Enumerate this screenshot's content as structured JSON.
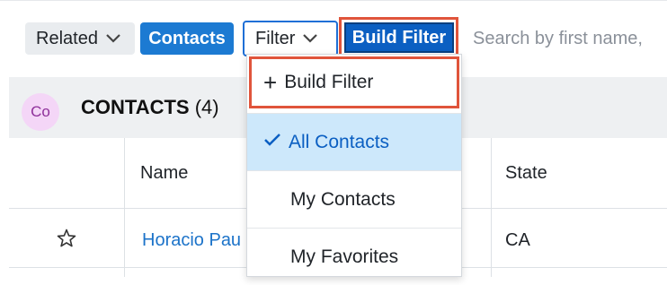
{
  "toolbar": {
    "related_label": "Related",
    "module_label": "Contacts",
    "filter_label": "Filter",
    "build_filter_label": "Build Filter",
    "search_placeholder": "Search by first name,"
  },
  "list_header": {
    "avatar_text": "Co",
    "title": "CONTACTS",
    "count": "(4)"
  },
  "table": {
    "columns": [
      "Name",
      "State"
    ],
    "rows": [
      {
        "name": "Horacio Pau",
        "state": "CA"
      }
    ]
  },
  "filter_dropdown": {
    "build_filter_item": "Build Filter",
    "items": [
      {
        "label": "All Contacts",
        "selected": true
      },
      {
        "label": "My Contacts",
        "selected": false
      },
      {
        "label": "My Favorites",
        "selected": false
      }
    ]
  },
  "colors": {
    "accent": "#1c7ad2",
    "highlight_outline": "#e0543b",
    "selected_bg": "#cde8fb",
    "avatar_bg": "#f4d6f7"
  }
}
